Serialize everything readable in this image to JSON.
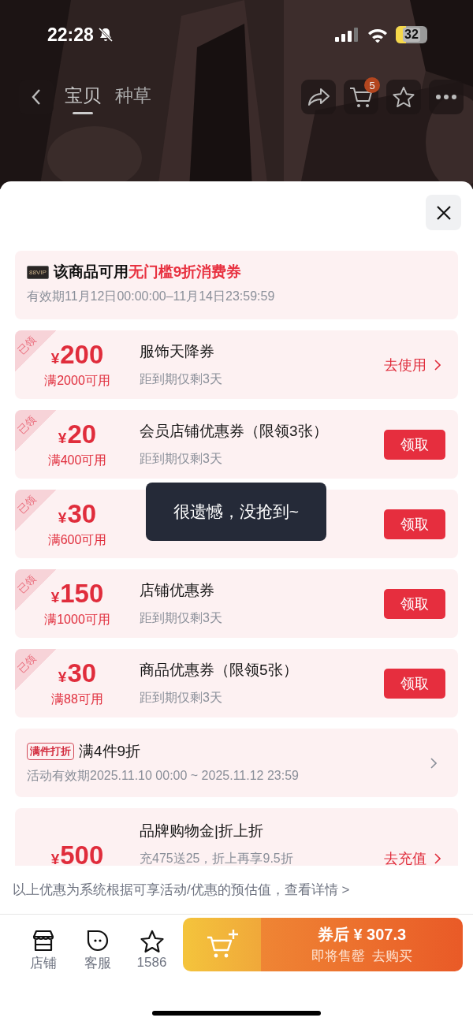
{
  "status_bar": {
    "time": "22:28",
    "battery": "32"
  },
  "nav": {
    "tabs": [
      {
        "label": "宝贝",
        "selected": true
      },
      {
        "label": "种草",
        "selected": false
      }
    ],
    "cart_badge": "5"
  },
  "promo": {
    "badge": "88VIP",
    "title_prefix": "该商品可用",
    "title_highlight": "无门槛9折消费券",
    "validity": "有效期11月12日00:00:00–11月14日23:59:59"
  },
  "coupons": [
    {
      "claimed": true,
      "claimed_label": "已领",
      "currency": "¥",
      "amount": "200",
      "condition": "满2000可用",
      "title": "服饰天降券",
      "subtitle": "距到期仅剩3天",
      "action": {
        "kind": "link",
        "label": "去使用"
      }
    },
    {
      "claimed": true,
      "claimed_label": "已领",
      "currency": "¥",
      "amount": "20",
      "condition": "满400可用",
      "title": "会员店铺优惠券（限领3张）",
      "subtitle": "距到期仅剩3天",
      "action": {
        "kind": "button",
        "label": "领取"
      }
    },
    {
      "claimed": true,
      "claimed_label": "已领",
      "currency": "¥",
      "amount": "30",
      "condition": "满600可用",
      "action": {
        "kind": "button",
        "label": "领取"
      }
    },
    {
      "claimed": true,
      "claimed_label": "已领",
      "currency": "¥",
      "amount": "150",
      "condition": "满1000可用",
      "title": "店铺优惠券",
      "subtitle": "距到期仅剩3天",
      "action": {
        "kind": "button",
        "label": "领取"
      }
    },
    {
      "claimed": true,
      "claimed_label": "已领",
      "currency": "¥",
      "amount": "30",
      "condition": "满88可用",
      "title": "商品优惠券（限领5张）",
      "subtitle": "距到期仅剩3天",
      "action": {
        "kind": "button",
        "label": "领取"
      }
    }
  ],
  "activity": {
    "tag": "满件打折",
    "title": "满4件9折",
    "period": "活动有效期2025.11.10 00:00 ~ 2025.11.12 23:59"
  },
  "topup": {
    "claimed": false,
    "currency": "¥",
    "amount": "500",
    "title": "品牌购物金|折上折",
    "subtitle": "充475送25，折上再享9.5折",
    "action": {
      "kind": "link",
      "label": "去充值"
    }
  },
  "disclaimer": "以上优惠为系统根据可享活动/优惠的预估值，查看详情 >",
  "toast": "很遗憾，没抢到~",
  "bottom_bar": {
    "items": [
      {
        "kind": "store",
        "label": "店铺"
      },
      {
        "kind": "service",
        "label": "客服"
      },
      {
        "kind": "favorite",
        "label": "1586"
      }
    ],
    "buy": {
      "price_line": "券后 ¥ 307.3",
      "status": "即将售罄",
      "cta": "去购买"
    }
  }
}
